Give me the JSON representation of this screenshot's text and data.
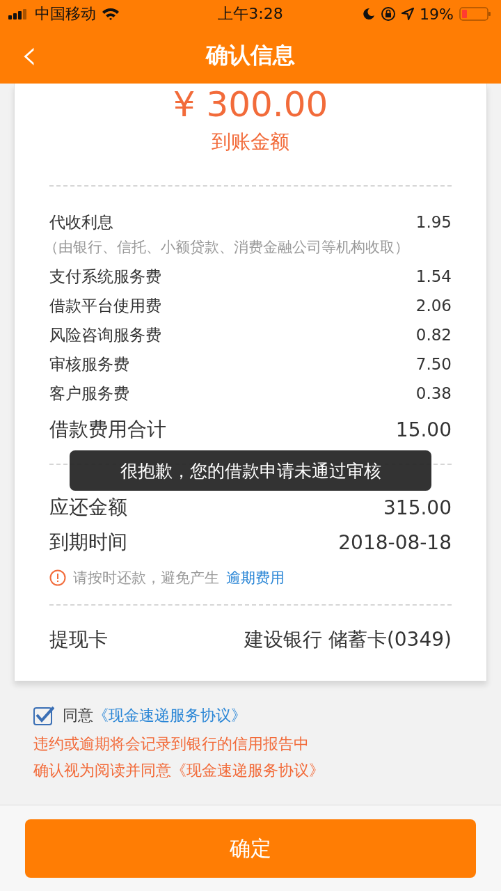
{
  "status_bar": {
    "carrier": "中国移动",
    "time": "上午3:28",
    "battery": "19%"
  },
  "nav": {
    "back": "‹",
    "title": "确认信息"
  },
  "amount": {
    "value": "¥ 300.00",
    "label": "到账金额"
  },
  "fees": [
    {
      "label": "代收利息",
      "value": "1.95",
      "note": "（由银行、信托、小额贷款、消费金融公司等机构收取）"
    },
    {
      "label": "支付系统服务费",
      "value": "1.54"
    },
    {
      "label": "借款平台使用费",
      "value": "2.06"
    },
    {
      "label": "风险咨询服务费",
      "value": "0.82"
    },
    {
      "label": "审核服务费",
      "value": "7.50"
    },
    {
      "label": "客户服务费",
      "value": "0.38"
    }
  ],
  "total": {
    "label": "借款费用合计",
    "value": "15.00"
  },
  "repay": [
    {
      "label": "应还金额",
      "value": "315.00"
    },
    {
      "label": "到期时间",
      "value": "2018-08-18"
    }
  ],
  "warning": {
    "text": "请按时还款，避免产生",
    "link": "逾期费用"
  },
  "card": {
    "label": "提现卡",
    "value": "建设银行 储蓄卡(0349)"
  },
  "agreement": {
    "checked": true,
    "text": "同意",
    "link": "《现金速递服务协议》"
  },
  "notices": [
    "违约或逾期将会记录到银行的信用报告中",
    "确认视为阅读并同意《现金速递服务协议》"
  ],
  "confirm_button": "确定",
  "toast": "很抱歉，您的借款申请未通过审核"
}
